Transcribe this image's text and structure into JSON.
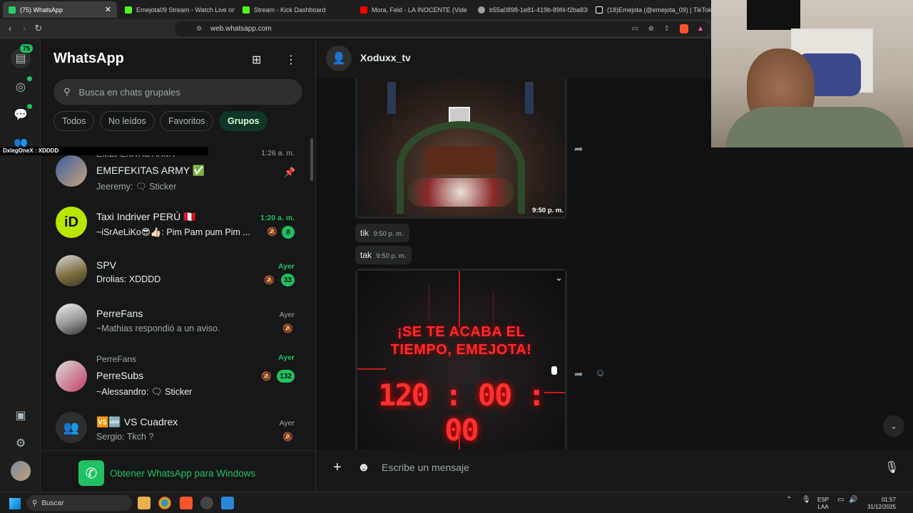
{
  "browser": {
    "tabs": [
      {
        "label": "(75) WhatsApp",
        "favicon_color": "#25d366"
      },
      {
        "label": "Emejota09 Stream - Watch Live on K",
        "favicon_color": "#53fc18"
      },
      {
        "label": "Stream - Kick Dashboard",
        "favicon_color": "#53fc18"
      },
      {
        "label": "Mora, Feid - LA INOCENTE (Vide",
        "favicon_color": "#ff0000"
      },
      {
        "label": "b55a0898-1e81-419b-89f4-f2ba830c",
        "favicon_color": "#9aa0a6"
      },
      {
        "label": "(18)Emejota (@emejota_09) | TikTok",
        "favicon_color": "#ffffff"
      }
    ],
    "url": "web.whatsapp.com"
  },
  "rail": {
    "unread_badge": "75"
  },
  "sidebar": {
    "title": "WhatsApp",
    "search_placeholder": "Busca en chats grupales",
    "filters": [
      "Todos",
      "No leídos",
      "Favoritos",
      "Grupos"
    ],
    "active_filter": "Grupos",
    "chats": [
      {
        "group_label": "EMEFEKITAS ARMY",
        "name": "EMEFEKITAS ARMY ✅",
        "preview": "Jeeremy: 🗨 Sticker",
        "time": "1:26 a. m.",
        "pinned": true
      },
      {
        "name": "Taxi Indriver PERÚ 🇵🇪",
        "preview": "~iSrAeLiKo😎👍🏻: Pim Pam pum  Pim ...",
        "time": "1:20 a. m.",
        "unread": "8",
        "muted": true
      },
      {
        "name": "SPV",
        "preview": "Drolias: XDDDD",
        "time": "Ayer",
        "unread": "33",
        "muted": true
      },
      {
        "name": "PerreFans",
        "preview": "~Mathias respondió a un aviso.",
        "time": "Ayer",
        "muted": true
      },
      {
        "group_label": "PerreFans",
        "name": "PerreSubs",
        "preview": "~Alessandro: 🗨 Sticker",
        "time": "Ayer",
        "unread": "132",
        "muted": true
      },
      {
        "name": "🆚🆕 VS Cuadrex",
        "preview": "Sergio: Tkch ?",
        "time": "Ayer",
        "muted": true
      }
    ],
    "get_windows": "Obtener WhatsApp para Windows"
  },
  "chat": {
    "contact": "Xoduxx_tv",
    "messages": [
      {
        "type": "image",
        "time": "9:50 p. m."
      },
      {
        "type": "text",
        "text": "tik",
        "time": "9:50 p. m."
      },
      {
        "type": "text",
        "text": "tak",
        "time": "9:50 p. m."
      },
      {
        "type": "image",
        "overlay_line1": "¡SE TE ACABA EL",
        "overlay_line2": "TIEMPO, EMEJOTA!",
        "countdown": "120 : 00 : 00"
      }
    ],
    "composer_placeholder": "Escribe un mensaje"
  },
  "overlay": {
    "viewer_tag": "DxlegOneX : XDDDD"
  },
  "taskbar": {
    "search": "Buscar",
    "lang_line1": "ESP",
    "lang_line2": "LAA",
    "clock_time": "01:57",
    "clock_date": "31/12/2025"
  },
  "colors": {
    "accent": "#21c063",
    "panel": "#161717",
    "bubble": "#242626"
  }
}
